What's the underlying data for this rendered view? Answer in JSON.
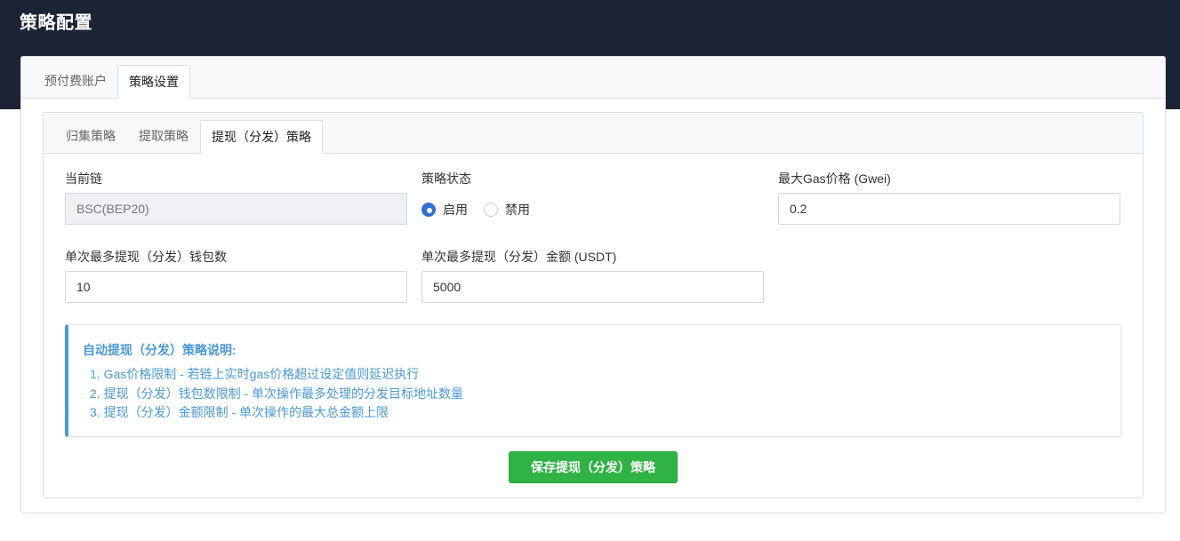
{
  "page": {
    "title": "策略配置"
  },
  "outer_tabs": [
    {
      "label": "预付费账户",
      "active": false
    },
    {
      "label": "策略设置",
      "active": true
    }
  ],
  "inner_tabs": [
    {
      "label": "归集策略",
      "active": false
    },
    {
      "label": "提取策略",
      "active": false
    },
    {
      "label": "提现（分发）策略",
      "active": true
    }
  ],
  "form": {
    "chain": {
      "label": "当前链",
      "value": "BSC(BEP20)"
    },
    "status": {
      "label": "策略状态",
      "options": [
        {
          "label": "启用",
          "checked": true
        },
        {
          "label": "禁用",
          "checked": false
        }
      ]
    },
    "max_gas": {
      "label": "最大Gas价格 (Gwei)",
      "value": "0.2"
    },
    "max_wallets": {
      "label": "单次最多提现（分发）钱包数",
      "value": "10"
    },
    "max_amount": {
      "label": "单次最多提现（分发）金额 (USDT)",
      "value": "5000"
    }
  },
  "notice": {
    "title": "自动提现（分发）策略说明:",
    "items": [
      "1. Gas价格限制 - 若链上实时gas价格超过设定值则延迟执行",
      "2. 提现（分发）钱包数限制 - 单次操作最多处理的分发目标地址数量",
      "3. 提现（分发）金额限制 - 单次操作的最大总金额上限"
    ]
  },
  "actions": {
    "save_label": "保存提现（分发）策略"
  },
  "colors": {
    "header_bg": "#1b2434",
    "accent_blue": "#4a9ad4",
    "radio_blue": "#2f6fd0",
    "save_green": "#2fb344"
  }
}
